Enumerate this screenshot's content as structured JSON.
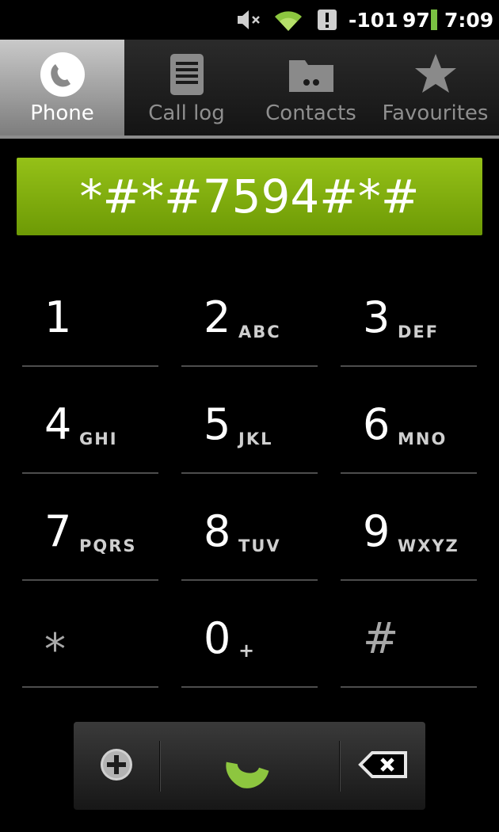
{
  "status_bar": {
    "mute_icon": "speaker-muted-icon",
    "wifi_icon": "wifi-icon",
    "alert_icon": "alert-icon",
    "signal": "-101",
    "battery": "97",
    "time": "7:09",
    "colors": {
      "wifi": "#8cc63f",
      "battery": "#7ac142"
    }
  },
  "tabs": [
    {
      "label": "Phone",
      "icon": "phone-icon",
      "active": true
    },
    {
      "label": "Call log",
      "icon": "call-log-icon",
      "active": false
    },
    {
      "label": "Contacts",
      "icon": "contacts-icon",
      "active": false
    },
    {
      "label": "Favourites",
      "icon": "star-icon",
      "active": false
    }
  ],
  "dial_input": {
    "value": "*#*#7594#*#"
  },
  "keypad": [
    {
      "digit": "1",
      "letters": ""
    },
    {
      "digit": "2",
      "letters": "ABC"
    },
    {
      "digit": "3",
      "letters": "DEF"
    },
    {
      "digit": "4",
      "letters": "GHI"
    },
    {
      "digit": "5",
      "letters": "JKL"
    },
    {
      "digit": "6",
      "letters": "MNO"
    },
    {
      "digit": "7",
      "letters": "PQRS"
    },
    {
      "digit": "8",
      "letters": "TUV"
    },
    {
      "digit": "9",
      "letters": "WXYZ"
    },
    {
      "digit": "*",
      "letters": ""
    },
    {
      "digit": "0",
      "letters": "+"
    },
    {
      "digit": "#",
      "letters": ""
    }
  ],
  "actions": {
    "add_contact_icon": "add-contact-icon",
    "call_icon": "call-icon",
    "backspace_icon": "backspace-icon",
    "call_color": "#8dc63f"
  }
}
